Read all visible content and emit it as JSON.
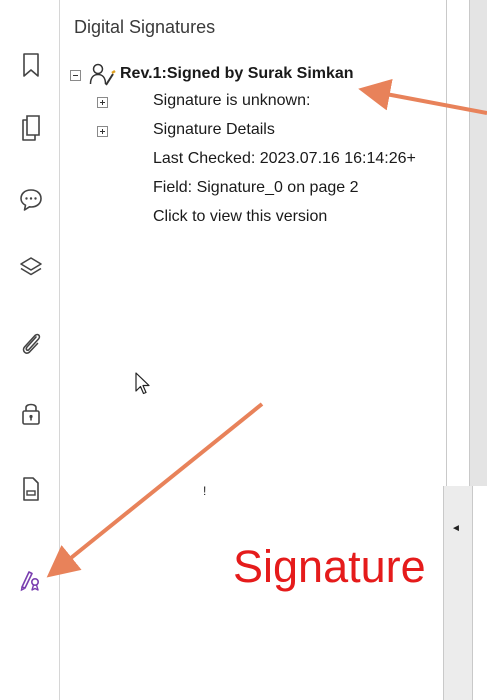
{
  "panel": {
    "title": "Digital Signatures",
    "signature": {
      "label": "Rev.1:Signed by Surak Simkan",
      "items": [
        {
          "label": "Signature is unknown:",
          "expandable": true
        },
        {
          "label": "Signature Details",
          "expandable": true
        },
        {
          "label": "Last Checked: 2023.07.16 16:14:26+",
          "expandable": false
        },
        {
          "label": "Field: Signature_0 on page 2",
          "expandable": false
        },
        {
          "label": "Click to view this version",
          "expandable": false
        }
      ]
    }
  },
  "rail": {
    "icons": [
      "bookmark-icon",
      "pages-icon",
      "comments-icon",
      "layers-icon",
      "attachments-icon",
      "security-lock-icon",
      "form-field-icon",
      "signature-panel-icon"
    ]
  },
  "document": {
    "signature_text": "Signature"
  },
  "stray_mark": "!",
  "colors": {
    "annotation_arrow": "#e8825a",
    "signature_text": "#e51b1b",
    "signature_icon": "#7a3fb0"
  }
}
